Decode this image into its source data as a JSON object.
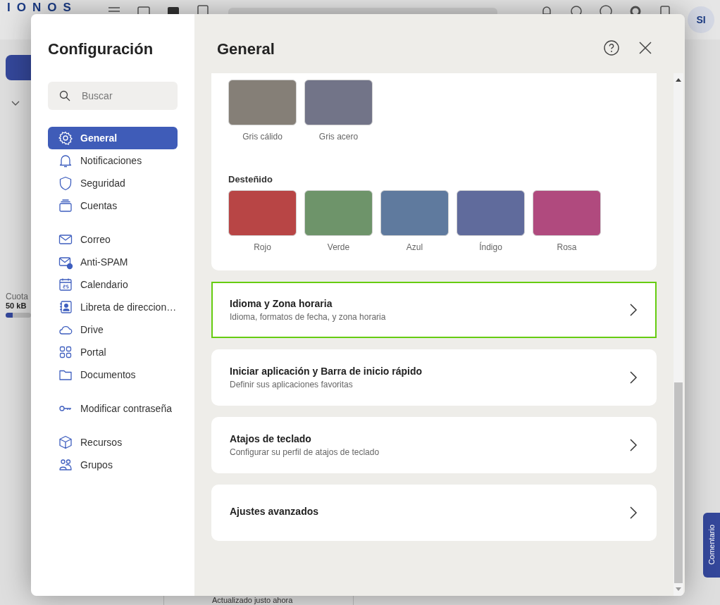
{
  "app": {
    "logo": "IONOS",
    "avatar": "SI",
    "quota_label": "Cuota",
    "quota_value": "50 kB",
    "status": "Actualizado justo ahora",
    "feedback_button": "Comentario"
  },
  "dialog": {
    "title": "Configuración",
    "search": {
      "placeholder": "Buscar"
    },
    "nav_groups": [
      [
        {
          "label": "General",
          "selected": true
        },
        {
          "label": "Notificaciones",
          "selected": false
        },
        {
          "label": "Seguridad",
          "selected": false
        },
        {
          "label": "Cuentas",
          "selected": false
        }
      ],
      [
        {
          "label": "Correo",
          "selected": false
        },
        {
          "label": "Anti-SPAM",
          "selected": false
        },
        {
          "label": "Calendario",
          "selected": false
        },
        {
          "label": "Libreta de direccion…",
          "selected": false
        },
        {
          "label": "Drive",
          "selected": false
        },
        {
          "label": "Portal",
          "selected": false
        },
        {
          "label": "Documentos",
          "selected": false
        }
      ],
      [
        {
          "label": "Modificar contraseña",
          "selected": false
        }
      ],
      [
        {
          "label": "Recursos",
          "selected": false
        },
        {
          "label": "Grupos",
          "selected": false
        }
      ]
    ],
    "heading": "General",
    "palette_groups": [
      {
        "swatches": [
          {
            "label": "Gris cálido",
            "color": "#857f77"
          },
          {
            "label": "Gris acero",
            "color": "#727488"
          }
        ]
      },
      {
        "title": "Desteñido",
        "swatches": [
          {
            "label": "Rojo",
            "color": "#b84545"
          },
          {
            "label": "Verde",
            "color": "#6e946a"
          },
          {
            "label": "Azul",
            "color": "#5f7a9e"
          },
          {
            "label": "Índigo",
            "color": "#606b9c"
          },
          {
            "label": "Rosa",
            "color": "#b04a7e"
          }
        ]
      }
    ],
    "cards": [
      {
        "title": "Idioma y Zona horaria",
        "subtitle": "Idioma, formatos de fecha, y zona horaria",
        "highlighted": true
      },
      {
        "title": "Iniciar aplicación y Barra de inicio rápido",
        "subtitle": "Definir sus aplicaciones favoritas",
        "highlighted": false
      },
      {
        "title": "Atajos de teclado",
        "subtitle": "Configurar su perfil de atajos de teclado",
        "highlighted": false
      },
      {
        "title": "Ajustes avanzados",
        "highlighted": false
      }
    ]
  }
}
